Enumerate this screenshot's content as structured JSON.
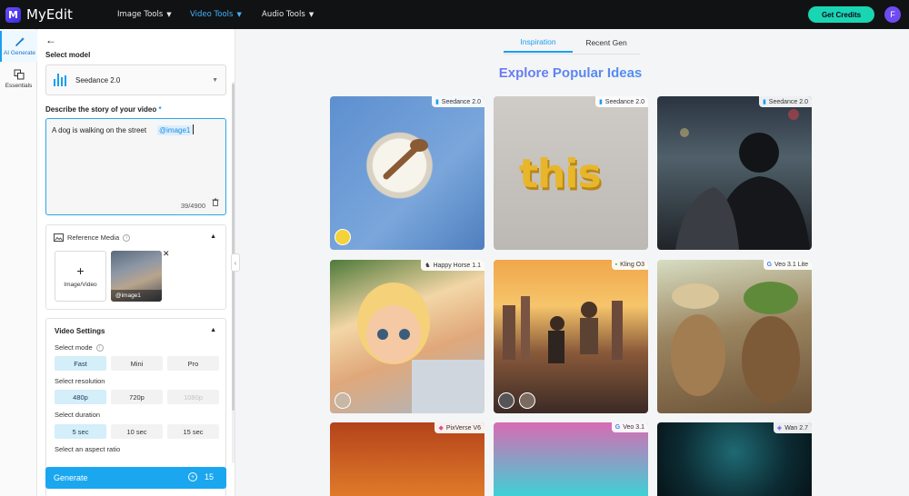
{
  "app": {
    "name": "MyEdit",
    "logo_letter": "M"
  },
  "nav": [
    {
      "label": "Image Tools",
      "active": false
    },
    {
      "label": "Video Tools",
      "active": true
    },
    {
      "label": "Audio Tools",
      "active": false
    }
  ],
  "header": {
    "credits_button": "Get Credits",
    "avatar_letter": "F"
  },
  "rail": [
    {
      "label": "AI Generate",
      "icon": "magic-wand-icon",
      "active": true
    },
    {
      "label": "Essentials",
      "icon": "layers-icon",
      "active": false
    }
  ],
  "panel": {
    "model_label": "Select model",
    "model_value": "Seedance 2.0",
    "story_label": "Describe the story of your video",
    "required_mark": "*",
    "prompt_text": "A dog is walking on the street",
    "prompt_tag": "@image1",
    "char_count": "39/4900",
    "reference": {
      "title": "Reference Media",
      "add_label": "Image/Video",
      "thumb_tag": "@image1"
    },
    "video_settings": {
      "title": "Video Settings",
      "mode_label": "Select mode",
      "modes": [
        "Fast",
        "Mini",
        "Pro"
      ],
      "resolution_label": "Select resolution",
      "resolutions": [
        "480p",
        "720p",
        "1080p"
      ],
      "duration_label": "Select duration",
      "durations": [
        "5 sec",
        "10 sec",
        "15 sec"
      ],
      "aspect_label": "Select an aspect ratio"
    },
    "generate": {
      "label": "Generate",
      "cost": "15"
    }
  },
  "main": {
    "tabs": [
      {
        "label": "Inspiration",
        "active": true
      },
      {
        "label": "Recent Gen",
        "active": false
      }
    ],
    "title": "Explore Popular Ideas",
    "cards": [
      {
        "model": "Seedance 2.0"
      },
      {
        "model": "Seedance 2.0",
        "overlay_text": "this"
      },
      {
        "model": "Seedance 2.0"
      },
      {
        "model": "Happy Horse 1.1"
      },
      {
        "model": "Kling O3"
      },
      {
        "model": "Veo 3.1 Lite"
      },
      {
        "model": "PixVerse V6"
      },
      {
        "model": "Veo 3.1"
      },
      {
        "model": "Wan 2.7"
      }
    ]
  },
  "colors": {
    "accent": "#1a9ef0",
    "credits": "#19d6b2",
    "topbar": "#111214"
  }
}
